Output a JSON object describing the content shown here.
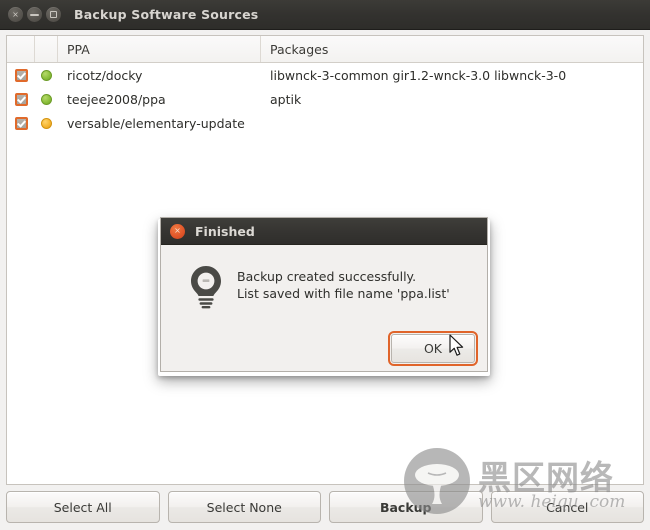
{
  "window": {
    "title": "Backup Software Sources",
    "controls": [
      {
        "name": "close",
        "glyph": "×"
      },
      {
        "name": "minimize",
        "glyph": "−"
      },
      {
        "name": "maximize",
        "glyph": "□"
      }
    ]
  },
  "table": {
    "columns": [
      {
        "key": "check",
        "label": ""
      },
      {
        "key": "status",
        "label": ""
      },
      {
        "key": "ppa",
        "label": "PPA"
      },
      {
        "key": "packages",
        "label": "Packages"
      }
    ],
    "rows": [
      {
        "checked": true,
        "status_color": "green",
        "ppa": "ricotz/docky",
        "packages": "libwnck-3-common gir1.2-wnck-3.0 libwnck-3-0"
      },
      {
        "checked": true,
        "status_color": "green",
        "ppa": "teejee2008/ppa",
        "packages": "aptik"
      },
      {
        "checked": true,
        "status_color": "orange",
        "ppa": "versable/elementary-update",
        "packages": ""
      }
    ]
  },
  "buttons": {
    "select_all": "Select All",
    "select_none": "Select None",
    "backup": "Backup",
    "cancel": "Cancel"
  },
  "dialog": {
    "title": "Finished",
    "close_glyph": "×",
    "message_line1": "Backup created successfully.",
    "message_line2": "List saved with file name 'ppa.list'",
    "ok_label": "OK",
    "icon": "lightbulb-icon"
  },
  "watermark": {
    "chinese": "黑区网络",
    "url": "www. heiqu. com"
  },
  "colors": {
    "accent_orange": "#e0642a",
    "titlebar_dark": "#35342f",
    "status_green": "#8cc03c",
    "status_orange": "#f6b733"
  }
}
